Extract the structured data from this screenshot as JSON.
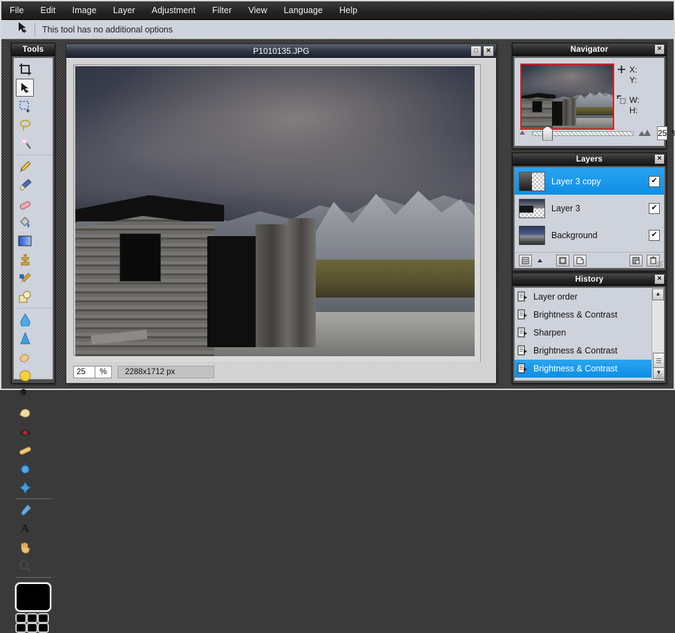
{
  "menubar": {
    "items": [
      {
        "label": "File"
      },
      {
        "label": "Edit"
      },
      {
        "label": "Image"
      },
      {
        "label": "Layer"
      },
      {
        "label": "Adjustment"
      },
      {
        "label": "Filter"
      },
      {
        "label": "View"
      },
      {
        "label": "Language"
      },
      {
        "label": "Help"
      }
    ]
  },
  "optionsbar": {
    "icon": "move-tool-icon",
    "text": "This tool has no additional options"
  },
  "tools": {
    "title": "Tools",
    "close_label": "✕",
    "items": [
      {
        "name": "crop-tool",
        "glyph": "⬚"
      },
      {
        "name": "move-tool",
        "glyph": "➤",
        "selected": true
      },
      {
        "name": "rectangle-select-tool",
        "glyph": "⬚"
      },
      {
        "name": "lasso-select-tool",
        "glyph": "❀"
      },
      {
        "name": "magic-wand-tool",
        "glyph": "✦"
      },
      {
        "name": "pencil-tool",
        "glyph": "✏"
      },
      {
        "name": "paintbrush-tool",
        "glyph": "🖌"
      },
      {
        "name": "eraser-tool",
        "glyph": "▭"
      },
      {
        "name": "paint-bucket-tool",
        "glyph": "☁"
      },
      {
        "name": "gradient-tool",
        "glyph": "▦"
      },
      {
        "name": "clone-stamp-tool",
        "glyph": "☗"
      },
      {
        "name": "recolor-tool",
        "glyph": "✒"
      },
      {
        "name": "shapes-tool",
        "glyph": "◰"
      },
      {
        "name": "blur-tool",
        "glyph": "💧"
      },
      {
        "name": "sharpen-tool",
        "glyph": "▲"
      },
      {
        "name": "smudge-tool",
        "glyph": "☞"
      },
      {
        "name": "dodge-tool",
        "glyph": "◆"
      },
      {
        "name": "burn-tool",
        "glyph": "⚫"
      },
      {
        "name": "sponge-tool",
        "glyph": "◖"
      },
      {
        "name": "red-eye-tool",
        "glyph": "◉"
      },
      {
        "name": "pill-tool",
        "glyph": "⬭"
      },
      {
        "name": "bloat-tool",
        "glyph": "●"
      },
      {
        "name": "pinch-tool",
        "glyph": "✴"
      },
      {
        "name": "color-picker-tool",
        "glyph": "╱"
      },
      {
        "name": "text-tool",
        "glyph": "A"
      },
      {
        "name": "pan-tool",
        "glyph": "✋"
      },
      {
        "name": "zoom-tool",
        "glyph": "🔍"
      }
    ],
    "primary_color": "#000000",
    "palette_colors": [
      "#000000",
      "#000000",
      "#000000",
      "#000000",
      "#000000",
      "#000000"
    ]
  },
  "document": {
    "title": "P1010135.JPG",
    "maximize_label": "□",
    "close_label": "✕",
    "status": {
      "zoom": "25",
      "zoom_unit": "%",
      "dimensions": "2288x1712 px"
    }
  },
  "navigator": {
    "title": "Navigator",
    "close_label": "✕",
    "cursor_icon": "crosshair-icon",
    "x_label": "X:",
    "y_label": "Y:",
    "selection_icon": "selection-bounds-icon",
    "w_label": "W:",
    "h_label": "H:",
    "zoom_out_icon": "small-mountain-icon",
    "zoom_in_icon": "large-mountain-icon",
    "zoom_value": "25",
    "zoom_unit": "%"
  },
  "layers": {
    "title": "Layers",
    "close_label": "✕",
    "items": [
      {
        "name": "Layer 3 copy",
        "visible": "✔",
        "selected": true
      },
      {
        "name": "Layer 3",
        "visible": "✔",
        "selected": false
      },
      {
        "name": "Background",
        "visible": "✔",
        "selected": false
      }
    ],
    "toolbar": [
      {
        "name": "layer-properties-button",
        "glyph": "≡"
      },
      {
        "name": "layer-expand-button",
        "glyph": "▲"
      },
      {
        "name": "merge-layer-button",
        "glyph": "▣"
      },
      {
        "name": "add-layer-button",
        "glyph": "▧"
      },
      {
        "name": "duplicate-layer-button",
        "glyph": "◨"
      },
      {
        "name": "delete-layer-button",
        "glyph": "🗑"
      }
    ]
  },
  "history": {
    "title": "History",
    "close_label": "✕",
    "items": [
      {
        "label": "Layer order",
        "selected": false
      },
      {
        "label": "Brightness & Contrast",
        "selected": false
      },
      {
        "label": "Sharpen",
        "selected": false
      },
      {
        "label": "Brightness & Contrast",
        "selected": false
      },
      {
        "label": "Brightness & Contrast",
        "selected": true
      }
    ],
    "scroll_up_label": "▲",
    "scroll_down_label": "▼"
  },
  "colors": {
    "accent": "#0d8fe6",
    "panel_header": "#1f1f1f",
    "panel_bg": "#cdd2db",
    "navigator_viewport_border": "#d91f1f"
  }
}
